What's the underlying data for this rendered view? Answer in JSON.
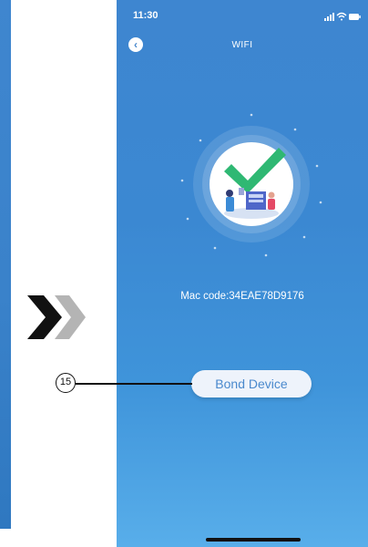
{
  "status_bar": {
    "time": "11:30"
  },
  "header": {
    "title": "WIFI"
  },
  "device": {
    "mac_label": "Mac code:",
    "mac_value": "34EAE78D9176"
  },
  "actions": {
    "bond_label": "Bond Device"
  },
  "callout": {
    "number": "15"
  },
  "colors": {
    "screen_top": "#3e86d0",
    "screen_bottom": "#58aeea",
    "check_green": "#2fb873",
    "button_text": "#4a89cd"
  },
  "icons": [
    "back-arrow-icon",
    "signal-icon",
    "wifi-icon",
    "battery-icon",
    "checkmark-icon",
    "chevrons-icon"
  ]
}
